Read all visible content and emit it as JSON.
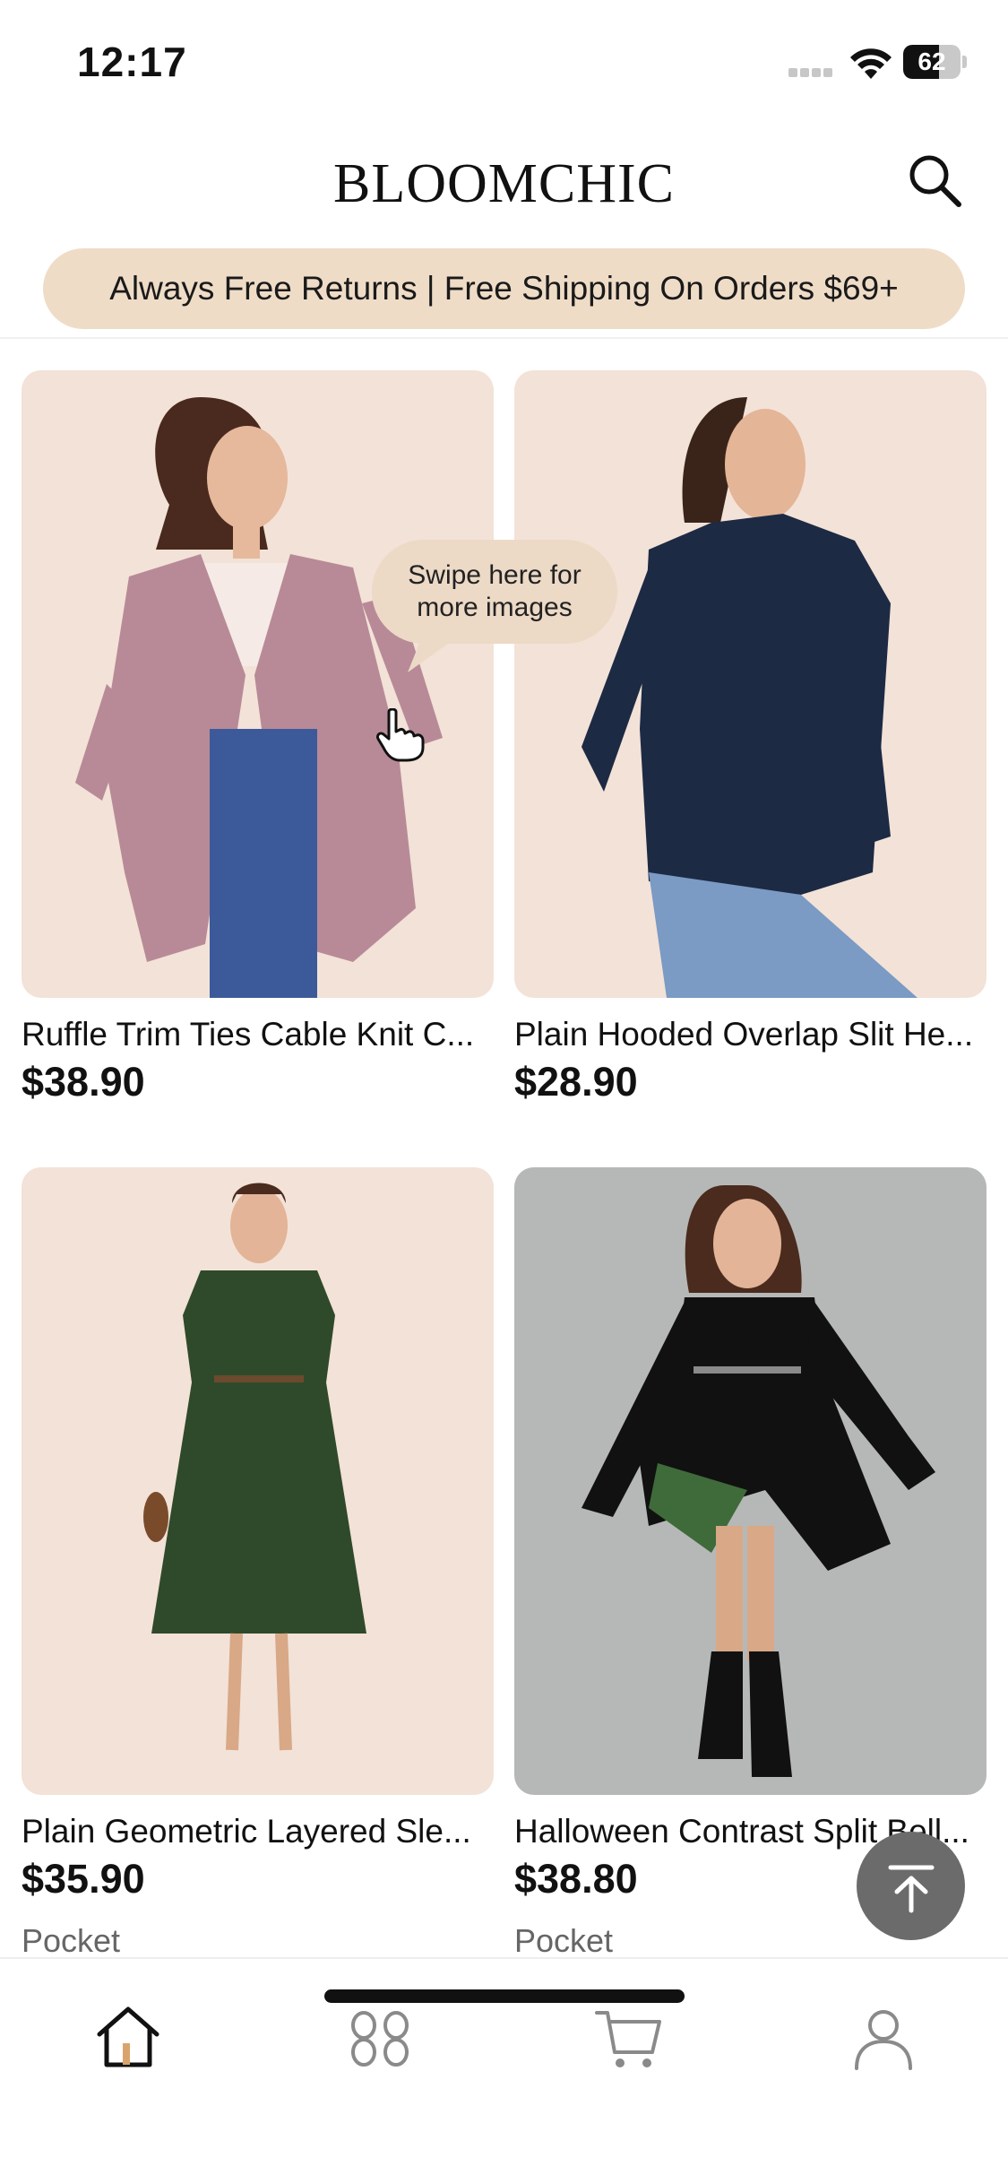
{
  "status_bar": {
    "time": "12:17",
    "battery_level": "62",
    "battery_fraction": 0.62
  },
  "header": {
    "logo": "BLOOMCHIC"
  },
  "promo_banner": {
    "text": "Always Free Returns | Free Shipping On Orders $69+"
  },
  "tooltip": {
    "line1": "Swipe here for",
    "line2": "more images"
  },
  "products": [
    {
      "name": "Ruffle Trim Ties Cable Knit C...",
      "price": "$38.90",
      "tag": ""
    },
    {
      "name": "Plain Hooded Overlap Slit He...",
      "price": "$28.90",
      "tag": ""
    },
    {
      "name": "Plain Geometric Layered Sle...",
      "price": "$35.90",
      "tag": "Pocket"
    },
    {
      "name": "Halloween Contrast Split Bell...",
      "price": "$38.80",
      "tag": "Pocket"
    }
  ],
  "tab_bar": {
    "items": [
      {
        "icon": "home-icon",
        "active": true
      },
      {
        "icon": "category-icon",
        "active": false
      },
      {
        "icon": "cart-icon",
        "active": false
      },
      {
        "icon": "account-icon",
        "active": false
      }
    ]
  },
  "colors": {
    "promo_bg": "#efdcc7",
    "image_bg_warm": "#f3e2d7",
    "image_bg_grey": "#b6b8b7",
    "active_accent": "#d9a46b"
  }
}
